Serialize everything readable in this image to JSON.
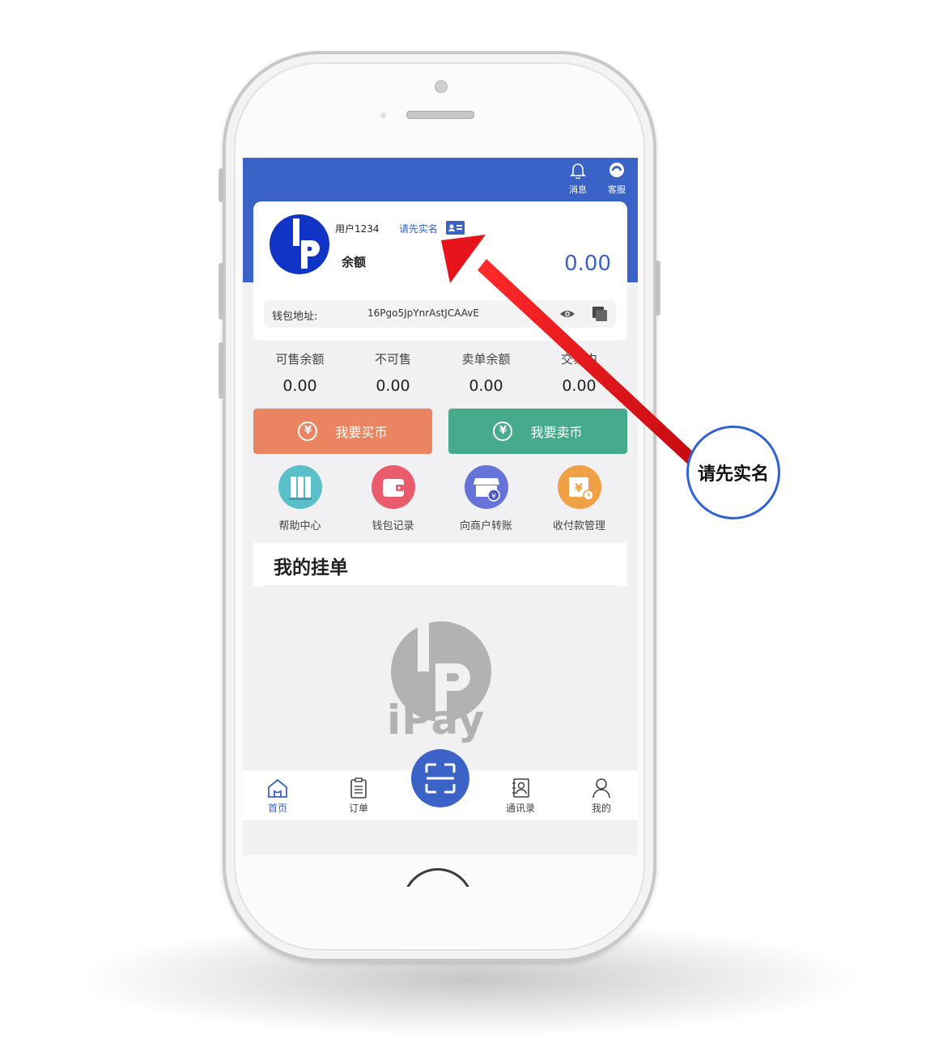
{
  "header": {
    "messages_label": "消息",
    "service_label": "客服"
  },
  "account": {
    "username": "用户1234",
    "verify_prompt": "请先实名",
    "balance_label": "余额",
    "balance_value": "0.00",
    "wallet_label": "钱包地址:",
    "wallet_address": "16Pgo5JpYnrAstJCAAvE"
  },
  "stats": [
    {
      "label": "可售余额",
      "value": "0.00"
    },
    {
      "label": "不可售",
      "value": "0.00"
    },
    {
      "label": "卖单余额",
      "value": "0.00"
    },
    {
      "label": "交易中",
      "value": "0.00"
    }
  ],
  "actions": {
    "buy_label": "我要买币",
    "sell_label": "我要卖币",
    "yen_glyph": "¥"
  },
  "grid": [
    {
      "label": "帮助中心",
      "icon": "books-icon",
      "color": "#5bbfc9"
    },
    {
      "label": "钱包记录",
      "icon": "wallet-icon",
      "color": "#ea5b6c"
    },
    {
      "label": "向商户转账",
      "icon": "store-icon",
      "color": "#6673d8"
    },
    {
      "label": "收付款管理",
      "icon": "receipt-icon",
      "color": "#f0a145"
    }
  ],
  "orders": {
    "title": "我的挂单"
  },
  "watermark": {
    "brand": "iPay"
  },
  "tabs": [
    {
      "label": "首页",
      "icon": "home-icon",
      "active": true
    },
    {
      "label": "订单",
      "icon": "clipboard-icon",
      "active": false
    },
    {
      "label": "通讯录",
      "icon": "contacts-icon",
      "active": false
    },
    {
      "label": "我的",
      "icon": "user-icon",
      "active": false
    }
  ],
  "annotation": {
    "callout_text": "请先实名"
  },
  "colors": {
    "primary": "#3a62c7",
    "buy": "#ea8461",
    "sell": "#46aa8c",
    "arrow": "#e8141b"
  }
}
